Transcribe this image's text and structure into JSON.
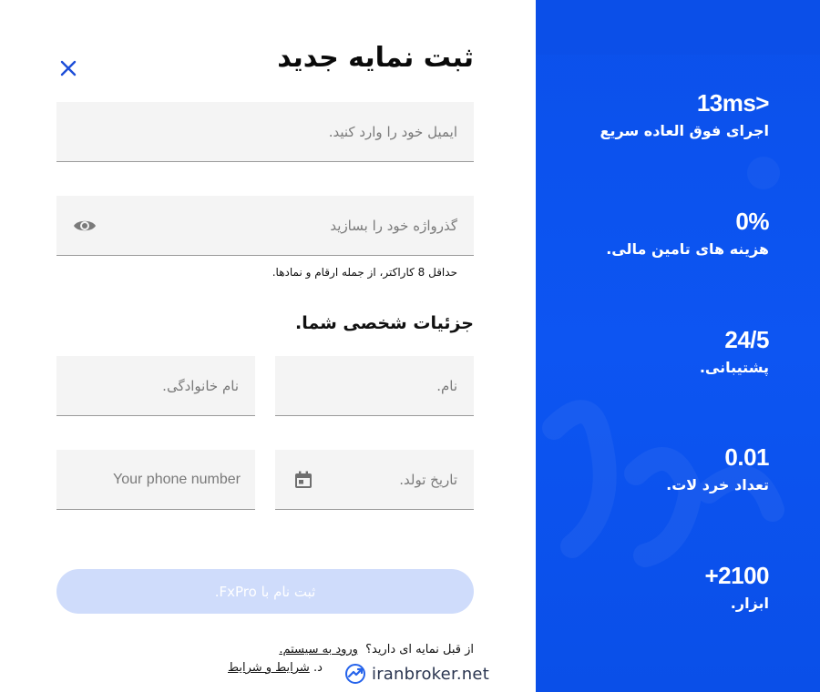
{
  "form": {
    "title": "ثبت نمایه جدید",
    "email_placeholder": "ایمیل خود را وارد کنید.",
    "password_placeholder": "گذرواژه خود را بسازید",
    "password_hint": "حداقل 8 کاراکتر، از جمله ارقام و نمادها.",
    "section_title": "جزئیات شخصی شما.",
    "first_name_placeholder": "نام.",
    "last_name_placeholder": "نام خانوادگی.",
    "birth_date_placeholder": "تاریخ تولد.",
    "phone_placeholder": "Your phone number",
    "submit_label": "ثبت نام با FxPro.",
    "have_account_text": "از قبل نمایه ای دارید؟",
    "login_link": "ورود به سیستم.",
    "terms_prefix": "د.",
    "terms_link": "شرایط و شرایط"
  },
  "stats": [
    {
      "value": "13ms>",
      "label": "اجرای فوق العاده سریع"
    },
    {
      "value": "0%",
      "label": "هزینه های تامین مالی."
    },
    {
      "value": "24/5",
      "label": "پشتیبانی."
    },
    {
      "value": "0.01",
      "label": "تعداد خرد لات."
    },
    {
      "value": "+2100",
      "label": "ابزار."
    }
  ],
  "watermark": {
    "text": "iranbroker.net",
    "icon": "trend-chart-icon"
  },
  "icons": {
    "close": "close-icon",
    "eye": "eye-icon",
    "calendar": "calendar-icon"
  },
  "colors": {
    "accent": "#1a56f0",
    "panel": "#0d55f2",
    "button_disabled": "#cfdcfb",
    "field_bg": "#f4f4f4"
  }
}
